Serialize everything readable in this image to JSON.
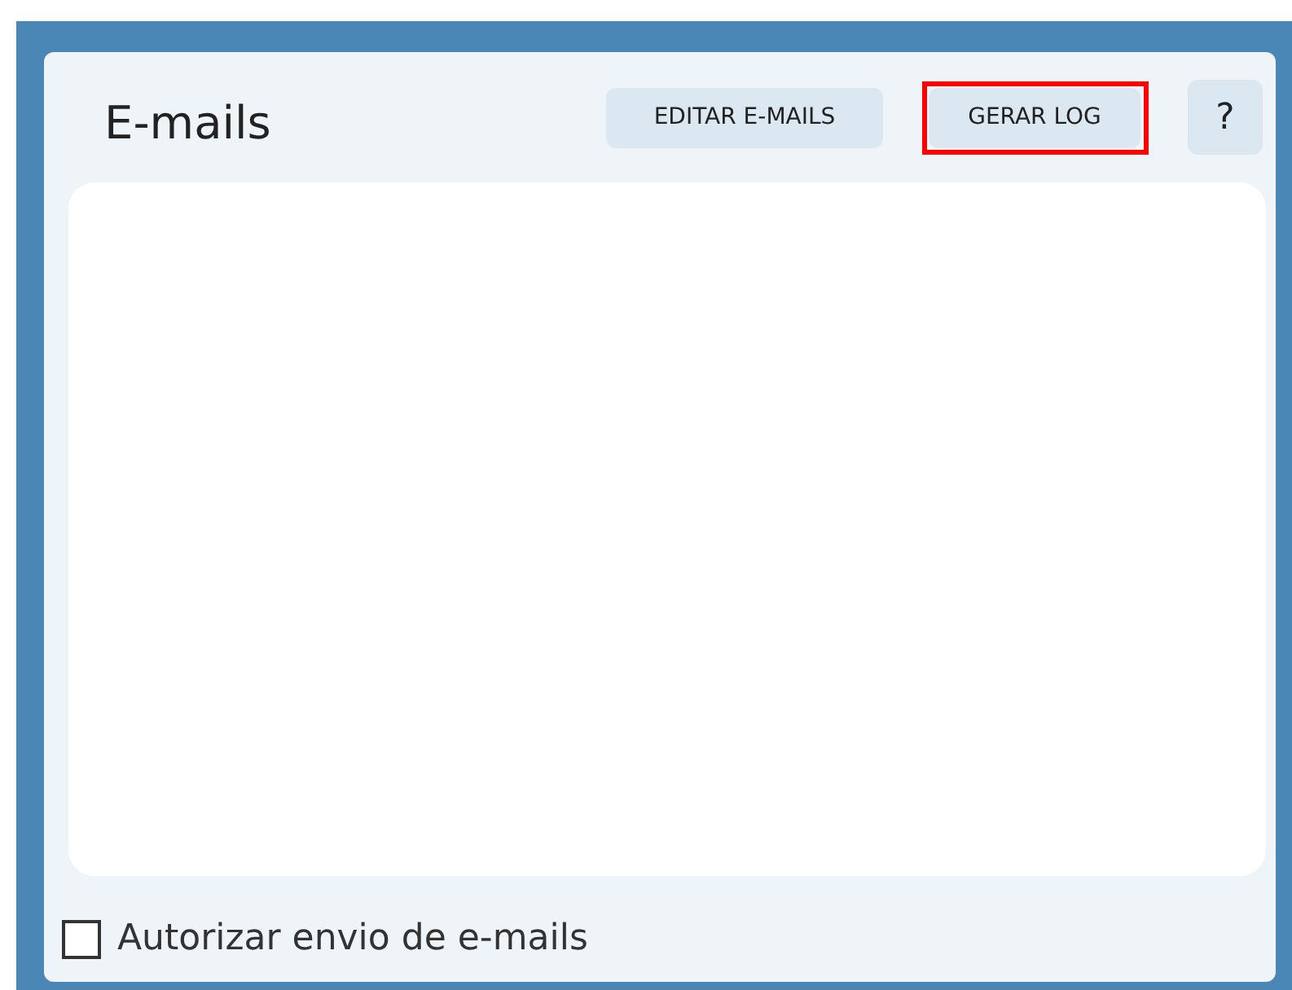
{
  "panel": {
    "title": "E-mails",
    "buttons": [
      {
        "label": "EDITAR E-MAILS",
        "highlighted": false
      },
      {
        "label": "GERAR LOG",
        "highlighted": true
      },
      {
        "label": "?",
        "highlighted": false
      }
    ],
    "checkbox": {
      "label": "Autorizar envio de e-mails",
      "checked": false
    }
  }
}
